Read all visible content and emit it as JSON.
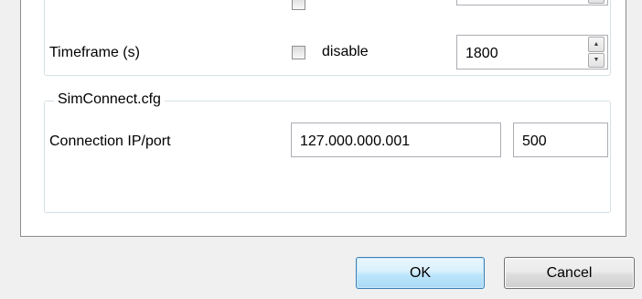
{
  "timeframe_row": {
    "label": "Timeframe (s)",
    "checkbox_label": "disable",
    "value": "1800"
  },
  "simconnect": {
    "group_title": "SimConnect.cfg",
    "connection_label": "Connection IP/port",
    "ip_value": "127.000.000.001",
    "port_value": "500"
  },
  "buttons": {
    "ok_label": "OK",
    "cancel_label": "Cancel"
  },
  "icons": {
    "spin_up": "spin-up-arrow-icon",
    "spin_down": "spin-down-arrow-icon"
  }
}
